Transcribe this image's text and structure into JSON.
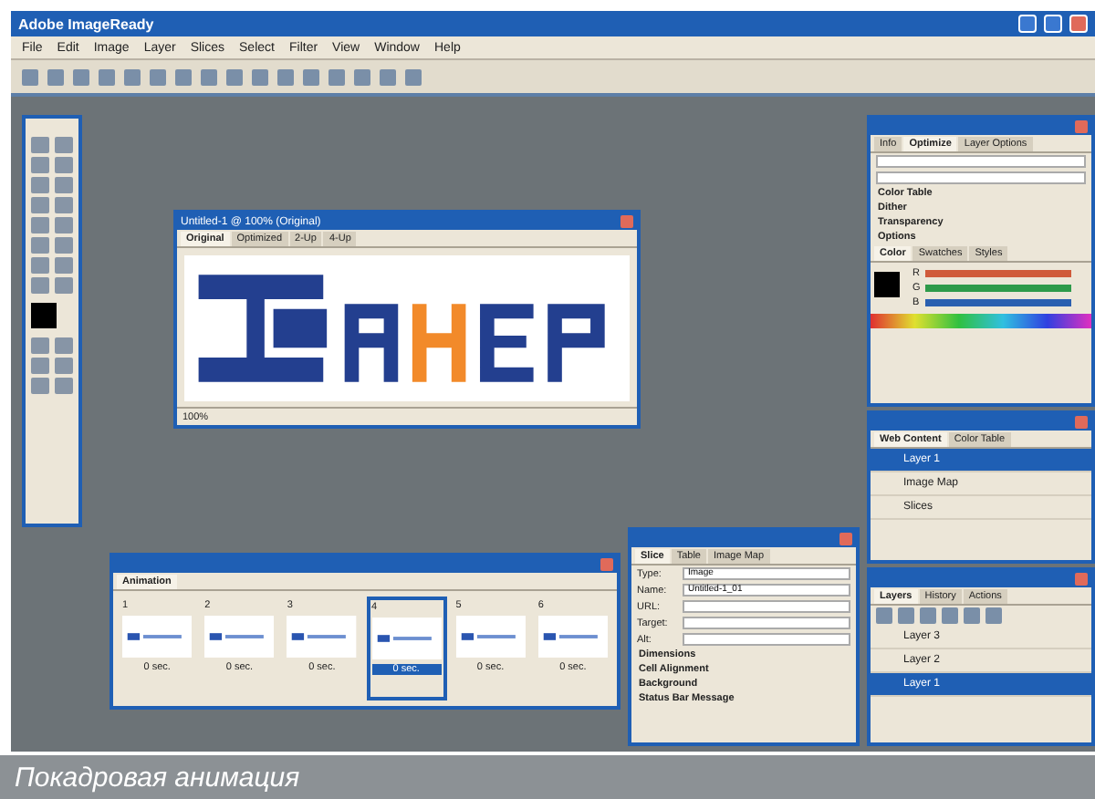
{
  "app": {
    "title": "Adobe ImageReady",
    "menu": [
      "File",
      "Edit",
      "Image",
      "Layer",
      "Slices",
      "Select",
      "Filter",
      "View",
      "Window",
      "Help"
    ]
  },
  "document": {
    "title": "Untitled-1 @ 100% (Original)",
    "tabs": [
      {
        "label": "Original",
        "selected": true
      },
      {
        "label": "Optimized",
        "selected": false
      },
      {
        "label": "2-Up",
        "selected": false
      },
      {
        "label": "4-Up",
        "selected": false
      }
    ],
    "zoom": "100%"
  },
  "animation": {
    "title": "Animation",
    "frames": [
      {
        "number": "1",
        "delay": "0 sec.",
        "selected": false
      },
      {
        "number": "2",
        "delay": "0 sec.",
        "selected": false
      },
      {
        "number": "3",
        "delay": "0 sec.",
        "selected": false
      },
      {
        "number": "4",
        "delay": "0 sec.",
        "selected": true
      },
      {
        "number": "5",
        "delay": "0 sec.",
        "selected": false
      },
      {
        "number": "6",
        "delay": "0 sec.",
        "selected": false
      }
    ]
  },
  "optimize_palette": {
    "tabs": [
      {
        "label": "Info",
        "selected": false
      },
      {
        "label": "Optimize",
        "selected": true
      },
      {
        "label": "Layer Options",
        "selected": false
      }
    ],
    "sections": [
      "Color Table",
      "Dither",
      "Transparency",
      "Options"
    ]
  },
  "color_palette": {
    "tabs": [
      {
        "label": "Color",
        "selected": true
      },
      {
        "label": "Swatches",
        "selected": false
      },
      {
        "label": "Styles",
        "selected": false
      }
    ],
    "channels": [
      {
        "name": "R",
        "color": "#d05a3a"
      },
      {
        "name": "G",
        "color": "#2e9a4a"
      },
      {
        "name": "B",
        "color": "#2a5fb0"
      }
    ]
  },
  "layers_palette": {
    "tabs": [
      {
        "label": "Web Content",
        "selected": true
      },
      {
        "label": "Color Table",
        "selected": false
      }
    ],
    "rows": [
      {
        "name": "Layer 1",
        "selected": true
      },
      {
        "name": "Image Map",
        "selected": false
      },
      {
        "name": "Slices",
        "selected": false
      }
    ]
  },
  "slice_palette": {
    "tabs": [
      {
        "label": "Slice",
        "selected": true
      },
      {
        "label": "Table",
        "selected": false
      },
      {
        "label": "Image Map",
        "selected": false
      }
    ],
    "fields": [
      {
        "label": "Type:",
        "value": "Image"
      },
      {
        "label": "Name:",
        "value": "Untitled-1_01"
      },
      {
        "label": "URL:"
      },
      {
        "label": "Target:"
      },
      {
        "label": "Alt:"
      }
    ],
    "sections": [
      "Dimensions",
      "Cell Alignment",
      "Background",
      "Status Bar Message"
    ]
  },
  "history_palette": {
    "tabs": [
      {
        "label": "Layers",
        "selected": true
      },
      {
        "label": "History",
        "selected": false
      },
      {
        "label": "Actions",
        "selected": false
      }
    ],
    "rows": [
      {
        "name": "Layer 3",
        "selected": false
      },
      {
        "name": "Layer 2",
        "selected": false
      },
      {
        "name": "Layer 1",
        "selected": true
      }
    ]
  },
  "caption": "Покадровая анимация"
}
